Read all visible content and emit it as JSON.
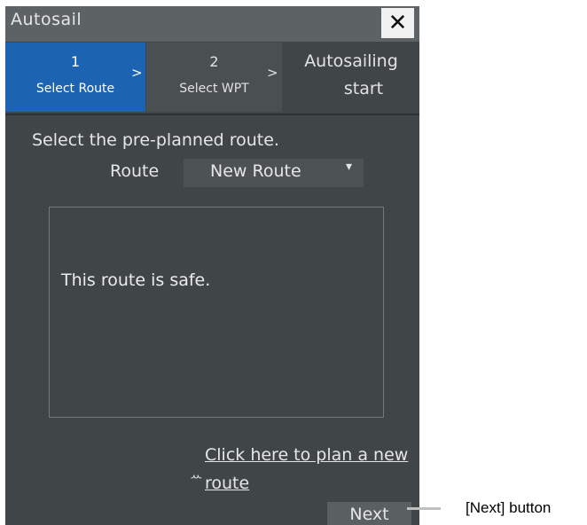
{
  "window": {
    "title": "Autosail",
    "close_label": "✕"
  },
  "steps": [
    {
      "number": "1",
      "label": "Select Route",
      "chevron": ">",
      "active": true
    },
    {
      "number": "2",
      "label": "Select WPT",
      "chevron": ">",
      "active": false
    },
    {
      "line1": "Autosailing",
      "line2": "start",
      "active": false
    }
  ],
  "instruction": "Select the pre-planned route.",
  "route": {
    "label": "Route",
    "selected": "New Route",
    "arrow": "▾"
  },
  "message": "This route is safe.",
  "plan_link": {
    "icon": "ꕀ",
    "text": "Click here to plan a new route"
  },
  "next_label": "Next",
  "annotation": "[Next] button",
  "colors": {
    "accent": "#1c64b2",
    "panel": "#404548",
    "titlebar": "#5d6265"
  }
}
